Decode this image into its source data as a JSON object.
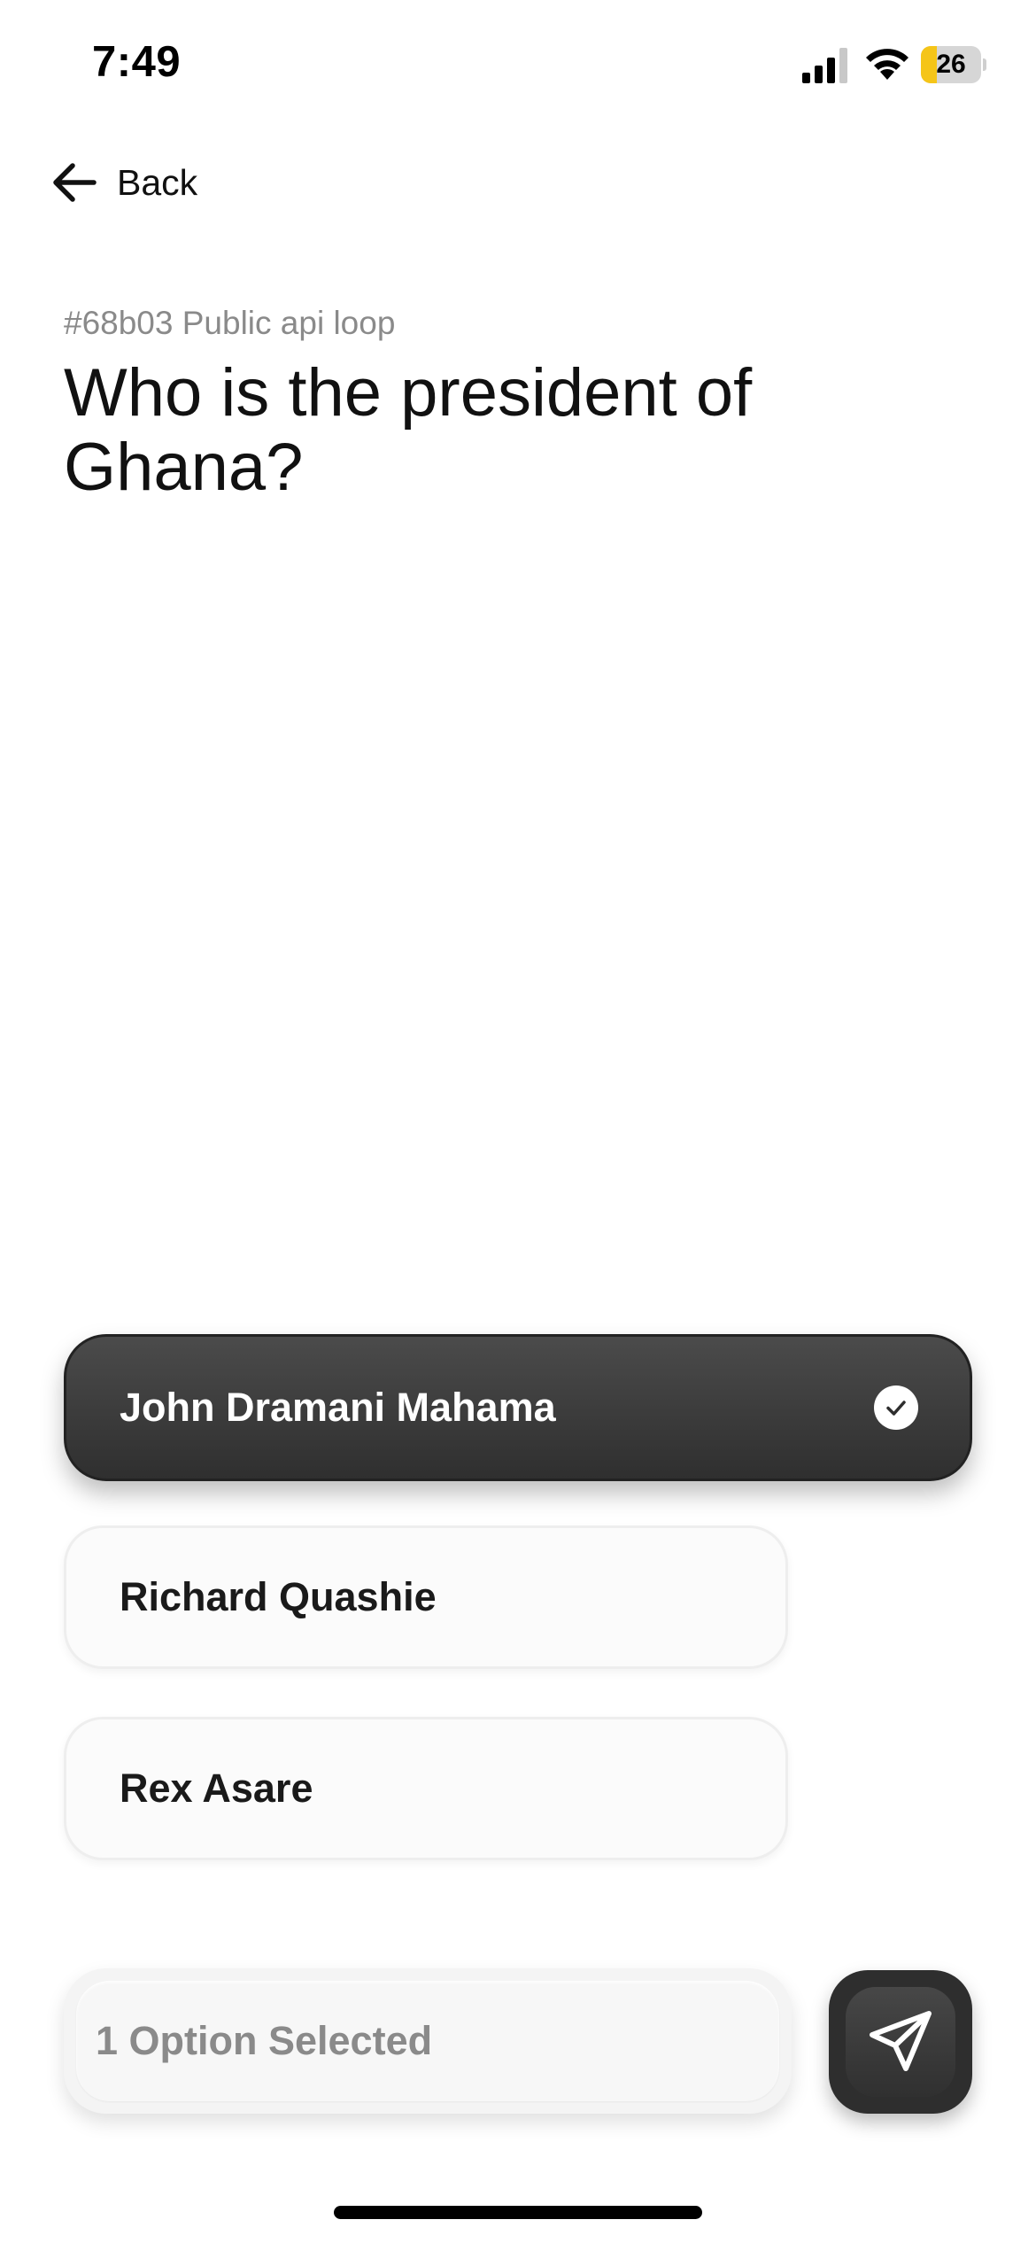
{
  "status_bar": {
    "time": "7:49",
    "battery_level": "26",
    "battery_fraction": 0.26,
    "battery_color": "#f5c518",
    "icons": [
      "signal-icon",
      "wifi-icon",
      "battery-icon"
    ]
  },
  "nav": {
    "back_label": "Back",
    "back_icon": "arrow-left-icon"
  },
  "question": {
    "meta": "#68b03 Public api loop",
    "title": "Who is the president of Ghana?"
  },
  "options": [
    {
      "label": "John Dramani Mahama",
      "selected": true
    },
    {
      "label": "Richard Quashie",
      "selected": false
    },
    {
      "label": "Rex Asare",
      "selected": false
    }
  ],
  "footer": {
    "selection_status": "1 Option Selected",
    "send_icon": "send-paper-plane-icon"
  },
  "colors": {
    "selected_option_bg": "#3a3a3a",
    "unselected_option_bg": "#fbfbfb",
    "send_button_bg": "#2e2e2e"
  }
}
